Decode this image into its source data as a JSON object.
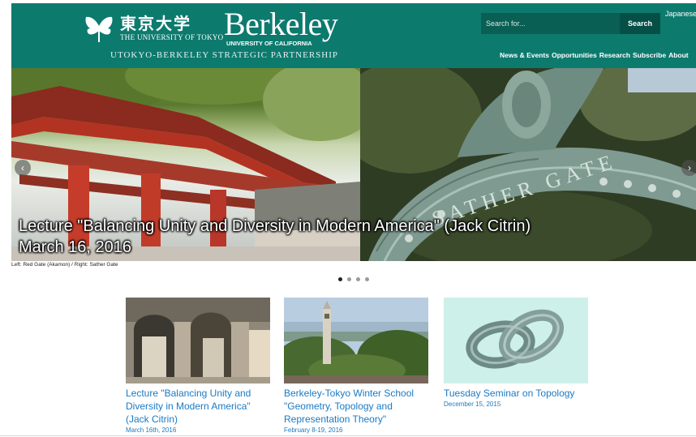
{
  "header": {
    "utokyo_kanji": "東京大学",
    "utokyo_en": "THE UNIVERSITY OF TOKYO",
    "berkeley_word": "Berkeley",
    "berkeley_sub": "UNIVERSITY OF CALIFORNIA",
    "partnership": "UTOKYO-BERKELEY STRATEGIC PARTNERSHIP",
    "search_placeholder": "Search for...",
    "search_button": "Search",
    "language": "Japanese",
    "nav": [
      "News & Events",
      "Opportunities",
      "Research",
      "Subscribe",
      "About"
    ],
    "accent_color": "#0d7a6e"
  },
  "hero": {
    "caption_line1": "Lecture \"Balancing Unity and Diversity in Modern America\" (Jack Citrin)",
    "caption_line2": "March 16, 2016",
    "gate_text": "SATHER GATE",
    "photo_credit": "Left: Red Gate (Akamon) / Right: Sather Gate",
    "slides": 4,
    "active_slide": 1
  },
  "cards": [
    {
      "title": "Lecture \"Balancing Unity and Diversity in Modern America\" (Jack Citrin)",
      "date": "March 16th, 2016"
    },
    {
      "title": "Berkeley-Tokyo Winter School \"Geometry, Topology and Representation Theory\"",
      "date": "February 8-19, 2016"
    },
    {
      "title": "Tuesday Seminar on Topology",
      "date": "December 15, 2015"
    }
  ],
  "link_color": "#1a7ac4"
}
